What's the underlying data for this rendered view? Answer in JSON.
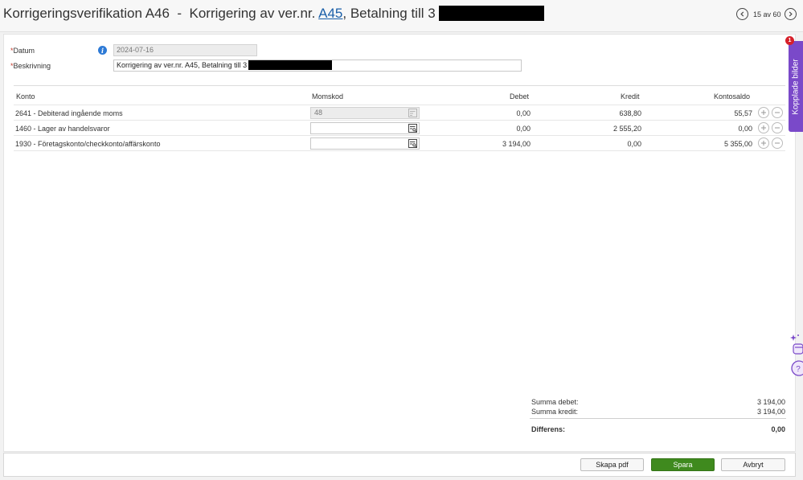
{
  "header": {
    "title_prefix": "Korrigeringsverifikation A46  -  Korrigering av ver.nr. ",
    "title_link": "A45",
    "title_suffix": ", Betalning till 3",
    "nav_count": "15 av 60"
  },
  "form": {
    "datum_label": "Datum",
    "datum_value": "2024-07-16",
    "beskrivning_label": "Beskrivning",
    "beskrivning_value": "Korrigering av ver.nr. A45, Betalning till 3",
    "required_marker": "*"
  },
  "table": {
    "columns": {
      "konto": "Konto",
      "momskod": "Momskod",
      "debet": "Debet",
      "kredit": "Kredit",
      "kontosaldo": "Kontosaldo"
    },
    "rows": [
      {
        "konto": "2641 - Debiterad ingående moms",
        "momskod": "48",
        "debet": "0,00",
        "kredit": "638,80",
        "kontosaldo": "55,57"
      },
      {
        "konto": "1460 - Lager av handelsvaror",
        "momskod": "",
        "debet": "0,00",
        "kredit": "2 555,20",
        "kontosaldo": "0,00"
      },
      {
        "konto": "1930 - Företagskonto/checkkonto/affärskonto",
        "momskod": "",
        "debet": "3 194,00",
        "kredit": "0,00",
        "kontosaldo": "5 355,00"
      }
    ]
  },
  "summary": {
    "summa_debet_label": "Summa debet:",
    "summa_debet_value": "3 194,00",
    "summa_kredit_label": "Summa kredit:",
    "summa_kredit_value": "3 194,00",
    "differens_label": "Differens:",
    "differens_value": "0,00"
  },
  "footer": {
    "pdf_label": "Skapa pdf",
    "save_label": "Spara",
    "cancel_label": "Avbryt"
  },
  "side_tab": {
    "label": "Kopplade bilder",
    "badge": "1"
  },
  "icons": {
    "prev": "chevron-left-icon",
    "next": "chevron-right-icon",
    "info": "info-icon",
    "lookup": "lookup-list-icon",
    "add": "plus-icon",
    "remove": "minus-icon"
  },
  "colors": {
    "link": "#1a5fa8",
    "primary_button": "#3f8a1e",
    "side_tab": "#7a49c9",
    "badge": "#d6202a",
    "info": "#2d7ad6"
  }
}
